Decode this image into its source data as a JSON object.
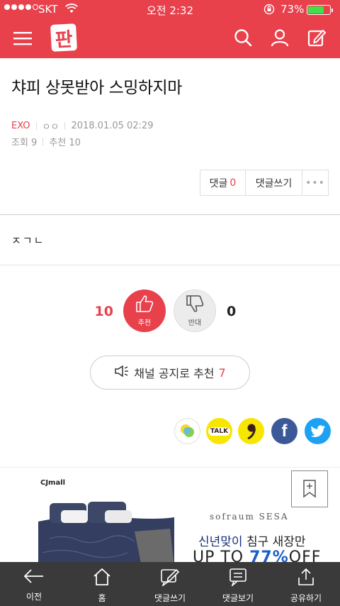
{
  "status_bar": {
    "carrier": "SKT",
    "time": "오전 2:32",
    "battery": "73%",
    "battery_level": 0.73,
    "signal_bars": 4
  },
  "app_bar": {
    "logo": "판",
    "icons": [
      "menu-icon",
      "search-icon",
      "user-icon",
      "compose-icon"
    ]
  },
  "article": {
    "title": "챠피 상못받아 스밍하지마",
    "channel": "EXO",
    "author": "ㅇㅇ",
    "date": "2018.01.05 02:29",
    "views_label": "조회 9",
    "recommend_label": "추천 10",
    "body": "ㅈㄱㄴ"
  },
  "actions": {
    "comment_label": "댓글",
    "comment_count": "0",
    "write_comment_label": "댓글쓰기",
    "more_label": "•••"
  },
  "vote": {
    "up_count": "10",
    "up_label": "추천",
    "down_label": "반대",
    "down_count": "0"
  },
  "notice": {
    "label": "채널 공지로 추천",
    "count": "7"
  },
  "share": {
    "talk_label": "TALK",
    "facebook_label": "f",
    "icons": [
      "kakao-story-icon",
      "kakao-talk-icon",
      "kakao-quote-icon",
      "facebook-icon",
      "twitter-icon"
    ]
  },
  "ad": {
    "advertiser_logo": "CJmall",
    "brand": "sofraum SESA",
    "headline_highlight": "신년맞이",
    "headline_rest": " 침구 새장만",
    "promo_prefix": "UP TO ",
    "promo_pct": "77%",
    "promo_suffix": "OFF"
  },
  "bottom_bar": {
    "tabs": [
      {
        "label": "이전",
        "icon": "back-arrow-icon"
      },
      {
        "label": "홈",
        "icon": "home-icon"
      },
      {
        "label": "댓글쓰기",
        "icon": "write-comment-icon"
      },
      {
        "label": "댓글보기",
        "icon": "view-comments-icon"
      },
      {
        "label": "공유하기",
        "icon": "share-icon"
      }
    ]
  },
  "colors": {
    "accent": "#e8414c",
    "bottom_bar": "#3a3a3a"
  }
}
